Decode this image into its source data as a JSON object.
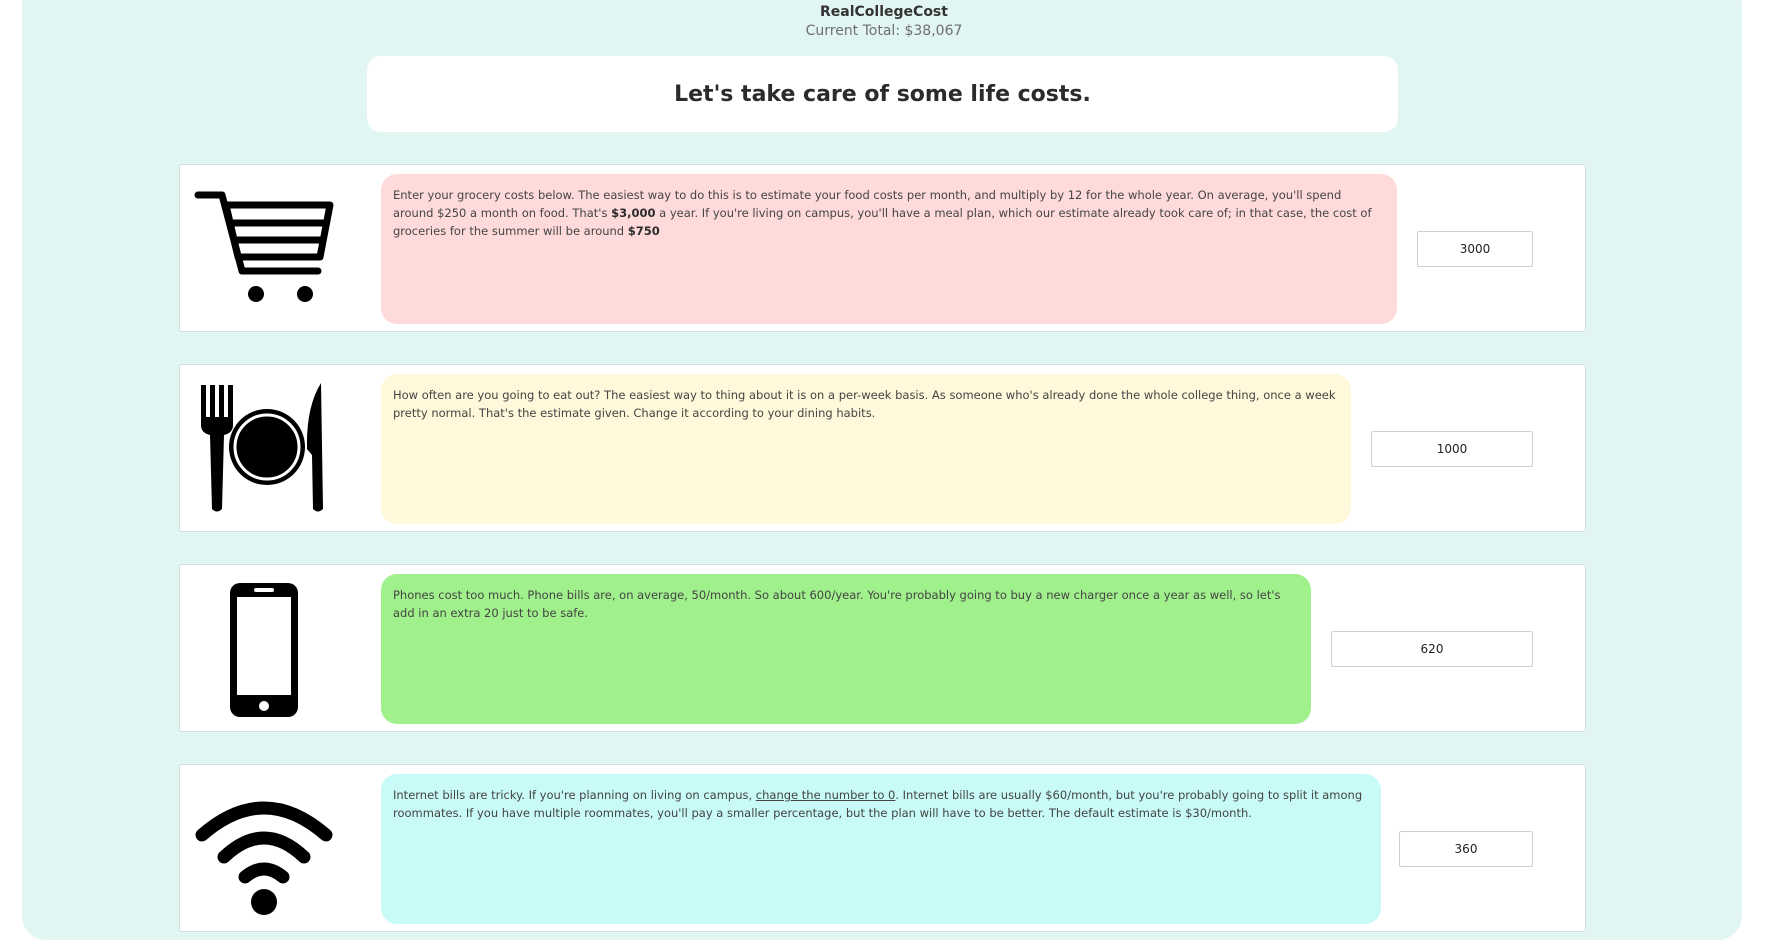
{
  "app": {
    "title": "RealCollegeCost",
    "total_label": "Current Total: $38,067"
  },
  "heading": "Let's take care of some life costs.",
  "rows": [
    {
      "icon": "shopping-cart-icon",
      "color": "#ffdada",
      "text_parts": [
        "Enter your grocery costs below. The easiest way to do this is to estimate your food costs per month, and multiply by 12 for the whole year. On average, you'll spend around $250 a month on food. That's ",
        "$3,000",
        " a year. If you're living on campus, you'll have a meal plan, which our estimate already took care of; in that case, the cost of groceries for the summer will be around ",
        "$750"
      ],
      "value": "3000"
    },
    {
      "icon": "dining-icon",
      "color": "#fff8da",
      "text_parts": [
        "How often are you going to eat out? The easiest way to thing about it is on a per-week basis. As someone who's already done the whole college thing, once a week pretty normal. That's the estimate given. Change it according to your dining habits."
      ],
      "value": "1000"
    },
    {
      "icon": "phone-icon",
      "color": "#a0f08c",
      "text_parts": [
        "Phones cost too much. Phone bills are, on average, 50/month. So about 600/year. You're probably going to buy a new charger once a year as well, so let's add in an extra 20 just to be safe."
      ],
      "value": "620"
    },
    {
      "icon": "wifi-icon",
      "color": "#c8fbf8",
      "text_parts": [
        "Internet bills are tricky. If you're planning on living on campus, ",
        "change the number to 0",
        ". Internet bills are usually $60/month, but you're probably going to split it among roommates. If you have multiple roommates, you'll pay a smaller percentage, but the plan will have to be better. The default estimate is $30/month."
      ],
      "value": "360"
    }
  ]
}
